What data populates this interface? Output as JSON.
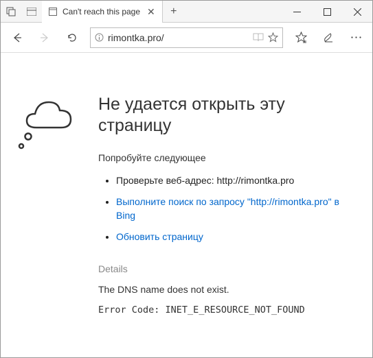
{
  "tab": {
    "title": "Can't reach this page"
  },
  "address": {
    "url": "rimontka.pro/"
  },
  "page": {
    "title": "Не удается открыть эту страницу",
    "try_label": "Попробуйте следующее",
    "suggestions": {
      "check_url": "Проверьте веб-адрес: http://rimontka.pro",
      "bing_search": "Выполните поиск по запросу \"http://rimontka.pro\" в Bing",
      "refresh": "Обновить страницу"
    },
    "details_label": "Details",
    "dns_message": "The DNS name does not exist.",
    "error_code_label": "Error Code: ",
    "error_code": "INET_E_RESOURCE_NOT_FOUND"
  }
}
